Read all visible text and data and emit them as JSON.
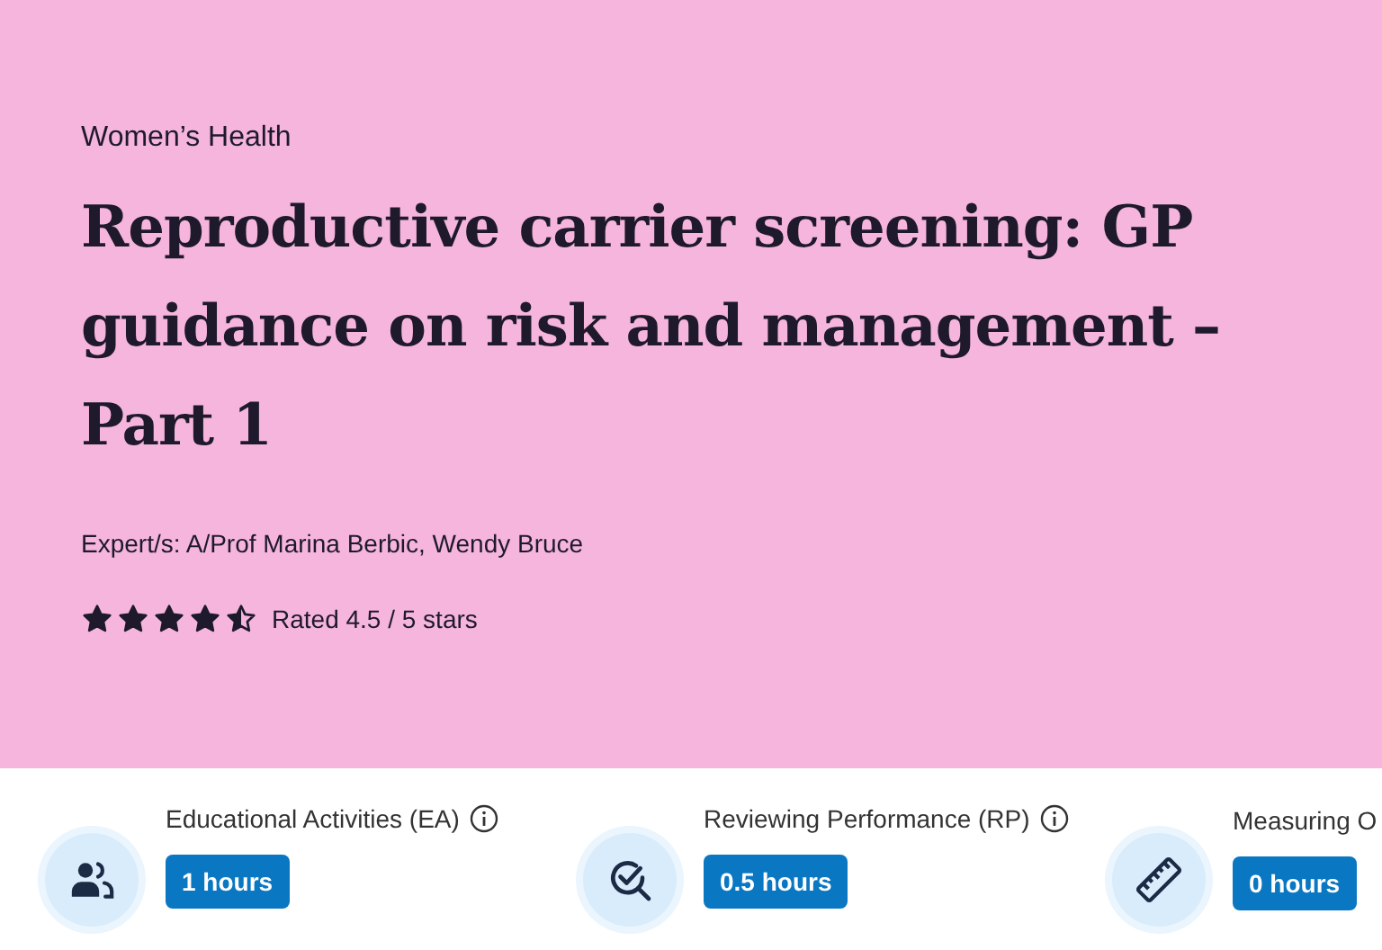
{
  "hero": {
    "category": "Women’s Health",
    "title": "Reproductive carrier screening: GP guidance on risk and management – Part 1",
    "experts": "Expert/s: A/Prof Marina Berbic, Wendy Bruce",
    "stars": 4.5,
    "rating": "Rated 4.5 / 5 stars"
  },
  "hours": [
    {
      "kind": "people",
      "label": "Educational Activities (EA)",
      "info": true,
      "value": "1 hours"
    },
    {
      "kind": "review",
      "label": "Reviewing Performance (RP)",
      "info": true,
      "value": "0.5 hours"
    },
    {
      "kind": "ruler",
      "label": "Measuring O",
      "info": false,
      "value": "0 hours"
    }
  ]
}
